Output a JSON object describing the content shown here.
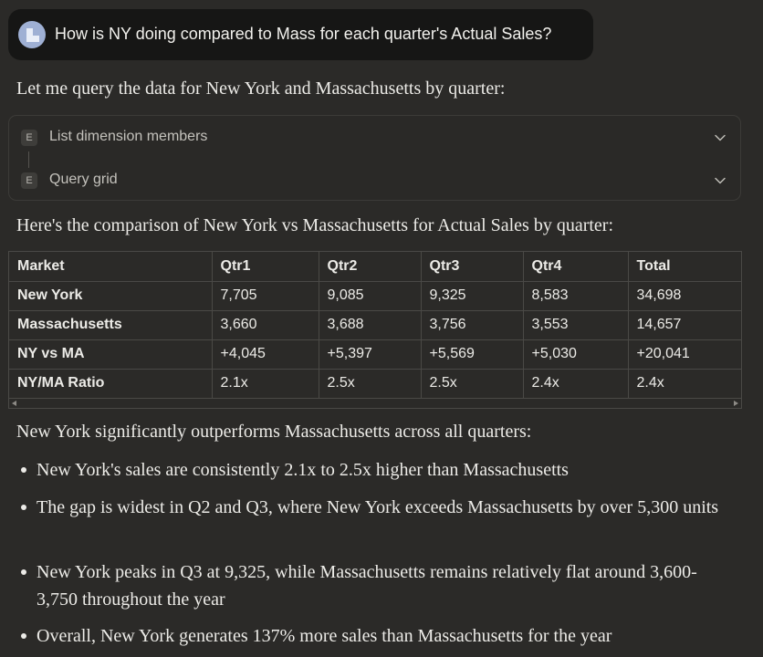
{
  "prompt": {
    "text": "How is NY doing compared to Mass for each quarter's Actual Sales?"
  },
  "response": {
    "intro": "Let me query the data for New York and Massachusetts by quarter:",
    "tools": [
      {
        "badge": "E",
        "label": "List dimension members"
      },
      {
        "badge": "E",
        "label": "Query grid"
      }
    ],
    "comparison_lead": "Here's the comparison of New York vs Massachusetts for Actual Sales by quarter:",
    "table": {
      "headers": [
        "Market",
        "Qtr1",
        "Qtr2",
        "Qtr3",
        "Qtr4",
        "Total"
      ],
      "rows": [
        [
          "New York",
          "7,705",
          "9,085",
          "9,325",
          "8,583",
          "34,698"
        ],
        [
          "Massachusetts",
          "3,660",
          "3,688",
          "3,756",
          "3,553",
          "14,657"
        ],
        [
          "NY vs MA",
          "+4,045",
          "+5,397",
          "+5,569",
          "+5,030",
          "+20,041"
        ],
        [
          "NY/MA Ratio",
          "2.1x",
          "2.5x",
          "2.5x",
          "2.4x",
          "2.4x"
        ]
      ]
    },
    "summary": "New York significantly outperforms Massachusetts across all quarters:",
    "bullets": [
      "New York's sales are consistently 2.1x to 2.5x higher than Massachusetts",
      "The gap is widest in Q2 and Q3, where New York exceeds Massachusetts by over 5,300 units",
      "New York peaks in Q3 at 9,325, while Massachusetts remains relatively flat around 3,600-3,750 throughout the year",
      "Overall, New York generates 137% more sales than Massachusetts for the year"
    ]
  },
  "icons": {
    "avatar": "user-avatar-icon",
    "expand": "chevron-down-icon",
    "scroll_left": "scroll-left-icon",
    "scroll_right": "scroll-right-icon"
  },
  "colors": {
    "background": "#2b2a28",
    "prompt_bubble": "#161615",
    "avatar": "#9fb0d4",
    "text": "#ecebe7",
    "border": "#4a4946"
  }
}
